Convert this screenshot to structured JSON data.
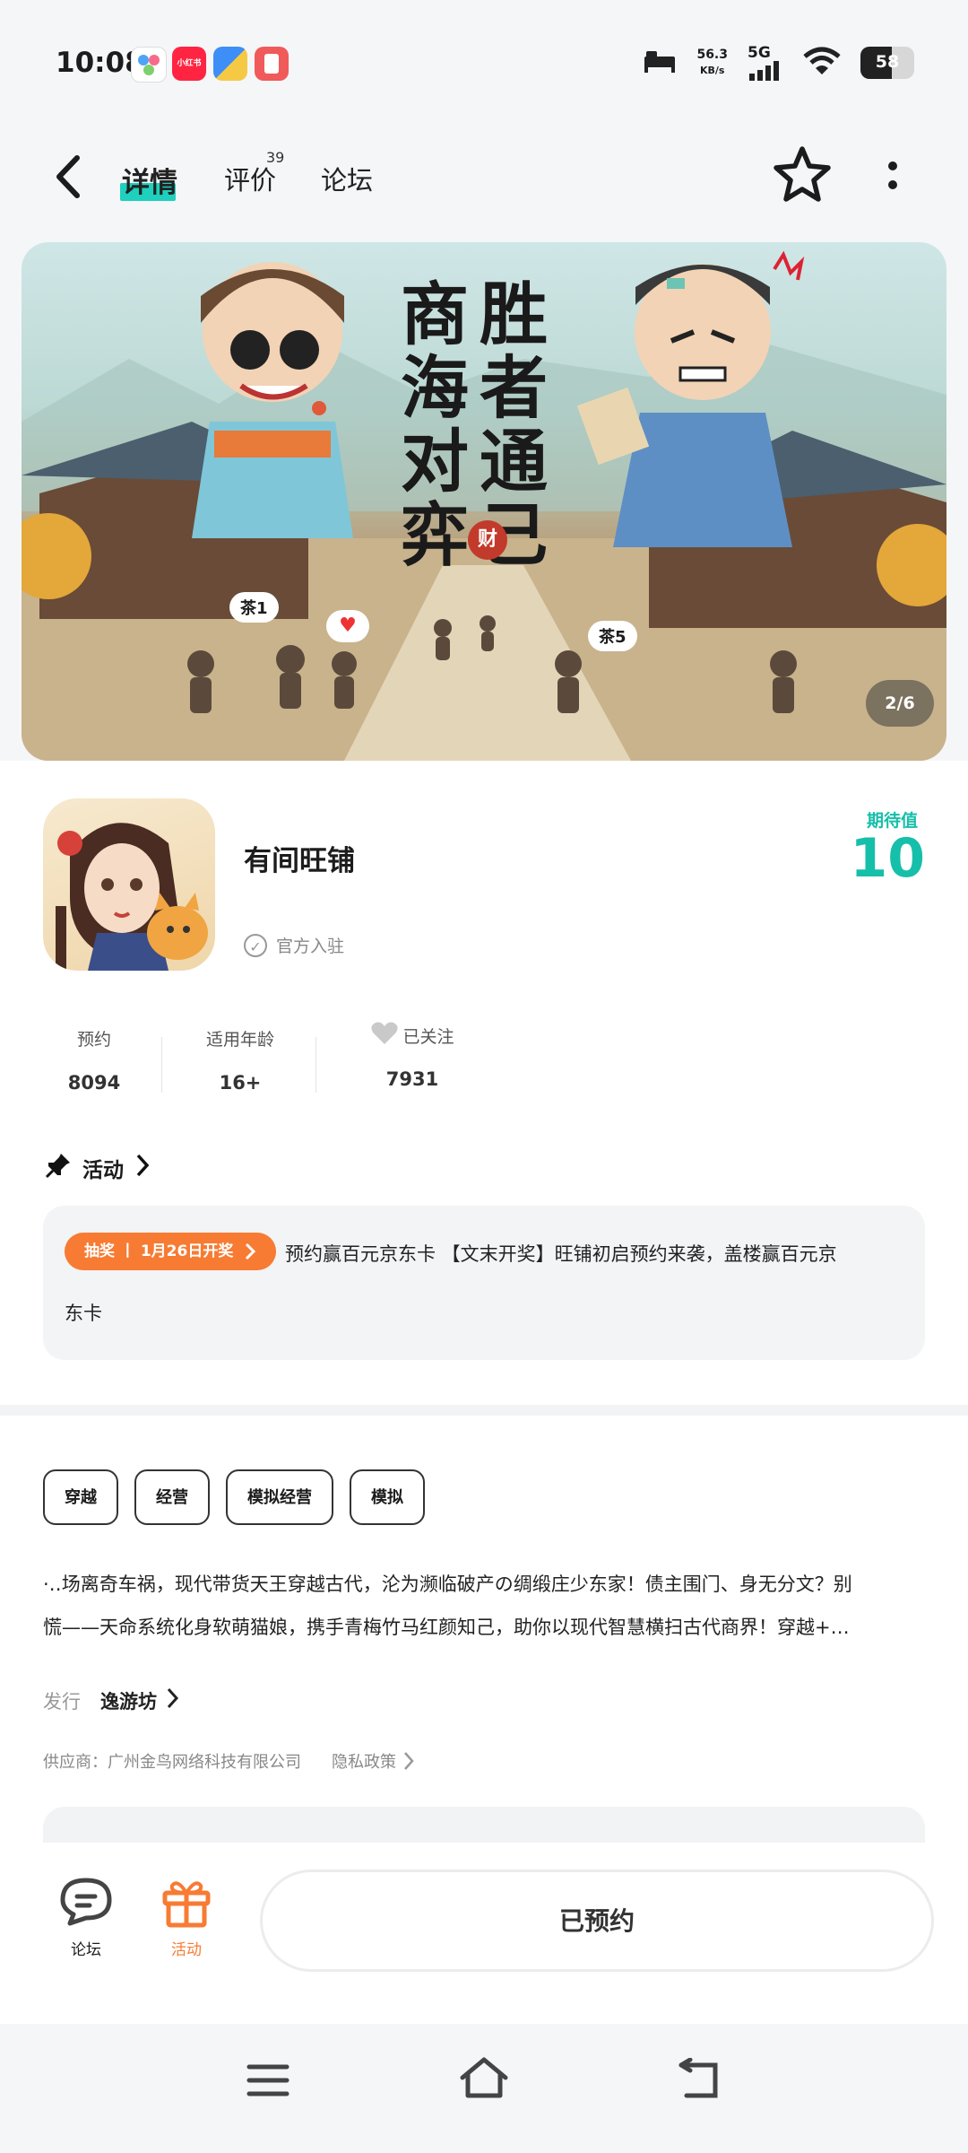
{
  "status_bar": {
    "time": "10:08",
    "net_speed": "56.3",
    "net_unit": "KB/s",
    "network": "5G",
    "battery": "58",
    "battery_level": 0.58,
    "app_icons": [
      "app-icon-1",
      "xiaohongshu-icon",
      "app-icon-3",
      "app-icon-4"
    ]
  },
  "nav": {
    "tabs": [
      {
        "label": "详情",
        "active": true
      },
      {
        "label": "评价",
        "badge": "39"
      },
      {
        "label": "论坛"
      }
    ],
    "back_icon": "back-arrow-icon",
    "favorite_icon": "star-icon",
    "more_icon": "more-icon"
  },
  "banner": {
    "page_indicator": "2/6",
    "title_left": "商海对弈",
    "title_right": "胜者通己",
    "seal": "财",
    "bubble_1": "茶1",
    "bubble_2": "茶5"
  },
  "app": {
    "name": "有间旺铺",
    "official_label": "官方入驻",
    "expect_label": "期待值",
    "expect_value": "10"
  },
  "stats": [
    {
      "label": "预约",
      "value": "8094"
    },
    {
      "label": "适用年龄",
      "value": "16+"
    },
    {
      "label": "已关注",
      "value": "7931"
    }
  ],
  "activity": {
    "header": "活动",
    "pill": "抽奖 丨 1月26日开奖",
    "text_line1": "预约赢百元京东卡 【文末开奖】旺铺初启预约来袭，盖楼赢百元京",
    "text_line2": "东卡"
  },
  "tags": [
    "穿越",
    "经营",
    "模拟经营",
    "模拟"
  ],
  "description": {
    "line1": "·‥场离奇车祸，现代带货天王穿越古代，沦为濒临破产の绸缎庄少东家！债主围门、身无分文？别",
    "line2": "慌——天命系统化身软萌猫娘，携手青梅竹马红颜知己，助你以现代智慧横扫古代商界！穿越+…"
  },
  "publisher": {
    "label": "发行",
    "name": "逸游坊"
  },
  "supplier": {
    "text": "供应商：广州金鸟网络科技有限公司",
    "privacy": "隐私政策"
  },
  "bottom_bar": {
    "forum_label": "论坛",
    "activity_label": "活动",
    "reserve_button": "已预约"
  },
  "colors": {
    "accent_teal": "#16bfa9",
    "orange": "#f77b33"
  }
}
